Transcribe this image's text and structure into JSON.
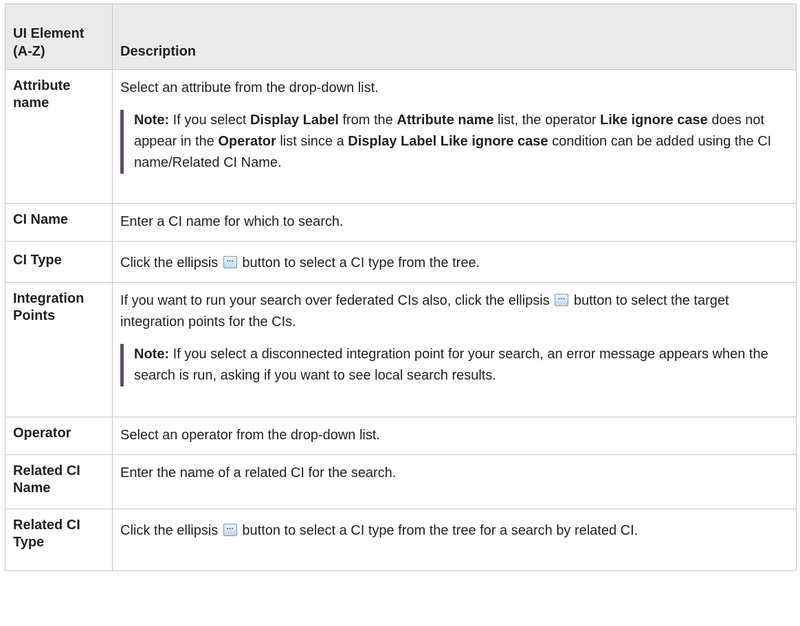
{
  "header": {
    "col1": "UI Element (A-Z)",
    "col2": "Description"
  },
  "rows": {
    "attribute_name": {
      "element": "Attribute name",
      "desc": "Select an attribute from the drop-down list.",
      "note": {
        "label": "Note:",
        "t1": " If you select ",
        "b1": "Display Label",
        "t2": " from the ",
        "b2": "Attribute name",
        "t3": " list, the operator ",
        "b3": "Like ignore case",
        "t4": " does not appear in the ",
        "b4": "Operator",
        "t5": " list since a ",
        "b5": "Display Label Like ignore case",
        "t6": " condition can be added using the CI name/Related CI Name."
      }
    },
    "ci_name": {
      "element": "CI Name",
      "desc": "Enter a CI name for which to search."
    },
    "ci_type": {
      "element": "CI Type",
      "desc_pre": "Click the ellipsis ",
      "desc_post": " button to select a CI type from the tree."
    },
    "integration_points": {
      "element": "Integration Points",
      "desc_pre": "If you want to run your search over federated CIs also, click the ellipsis ",
      "desc_post": " button to select the target integration points for the CIs.",
      "note": {
        "label": "Note:",
        "text": " If you select a disconnected integration point for your search, an error message appears when the search is run, asking if you want to see local search results."
      }
    },
    "operator": {
      "element": "Operator",
      "desc": "Select an operator from the drop-down list."
    },
    "related_ci_name": {
      "element": "Related CI Name",
      "desc": "Enter the name of a related CI for the search."
    },
    "related_ci_type": {
      "element": "Related CI Type",
      "desc_pre": "Click the ellipsis ",
      "desc_post": " button to select a CI type from the tree for a search by related CI."
    }
  },
  "icons": {
    "ellipsis": "ellipsis-button-icon",
    "ellipsis_glyph": "···"
  }
}
